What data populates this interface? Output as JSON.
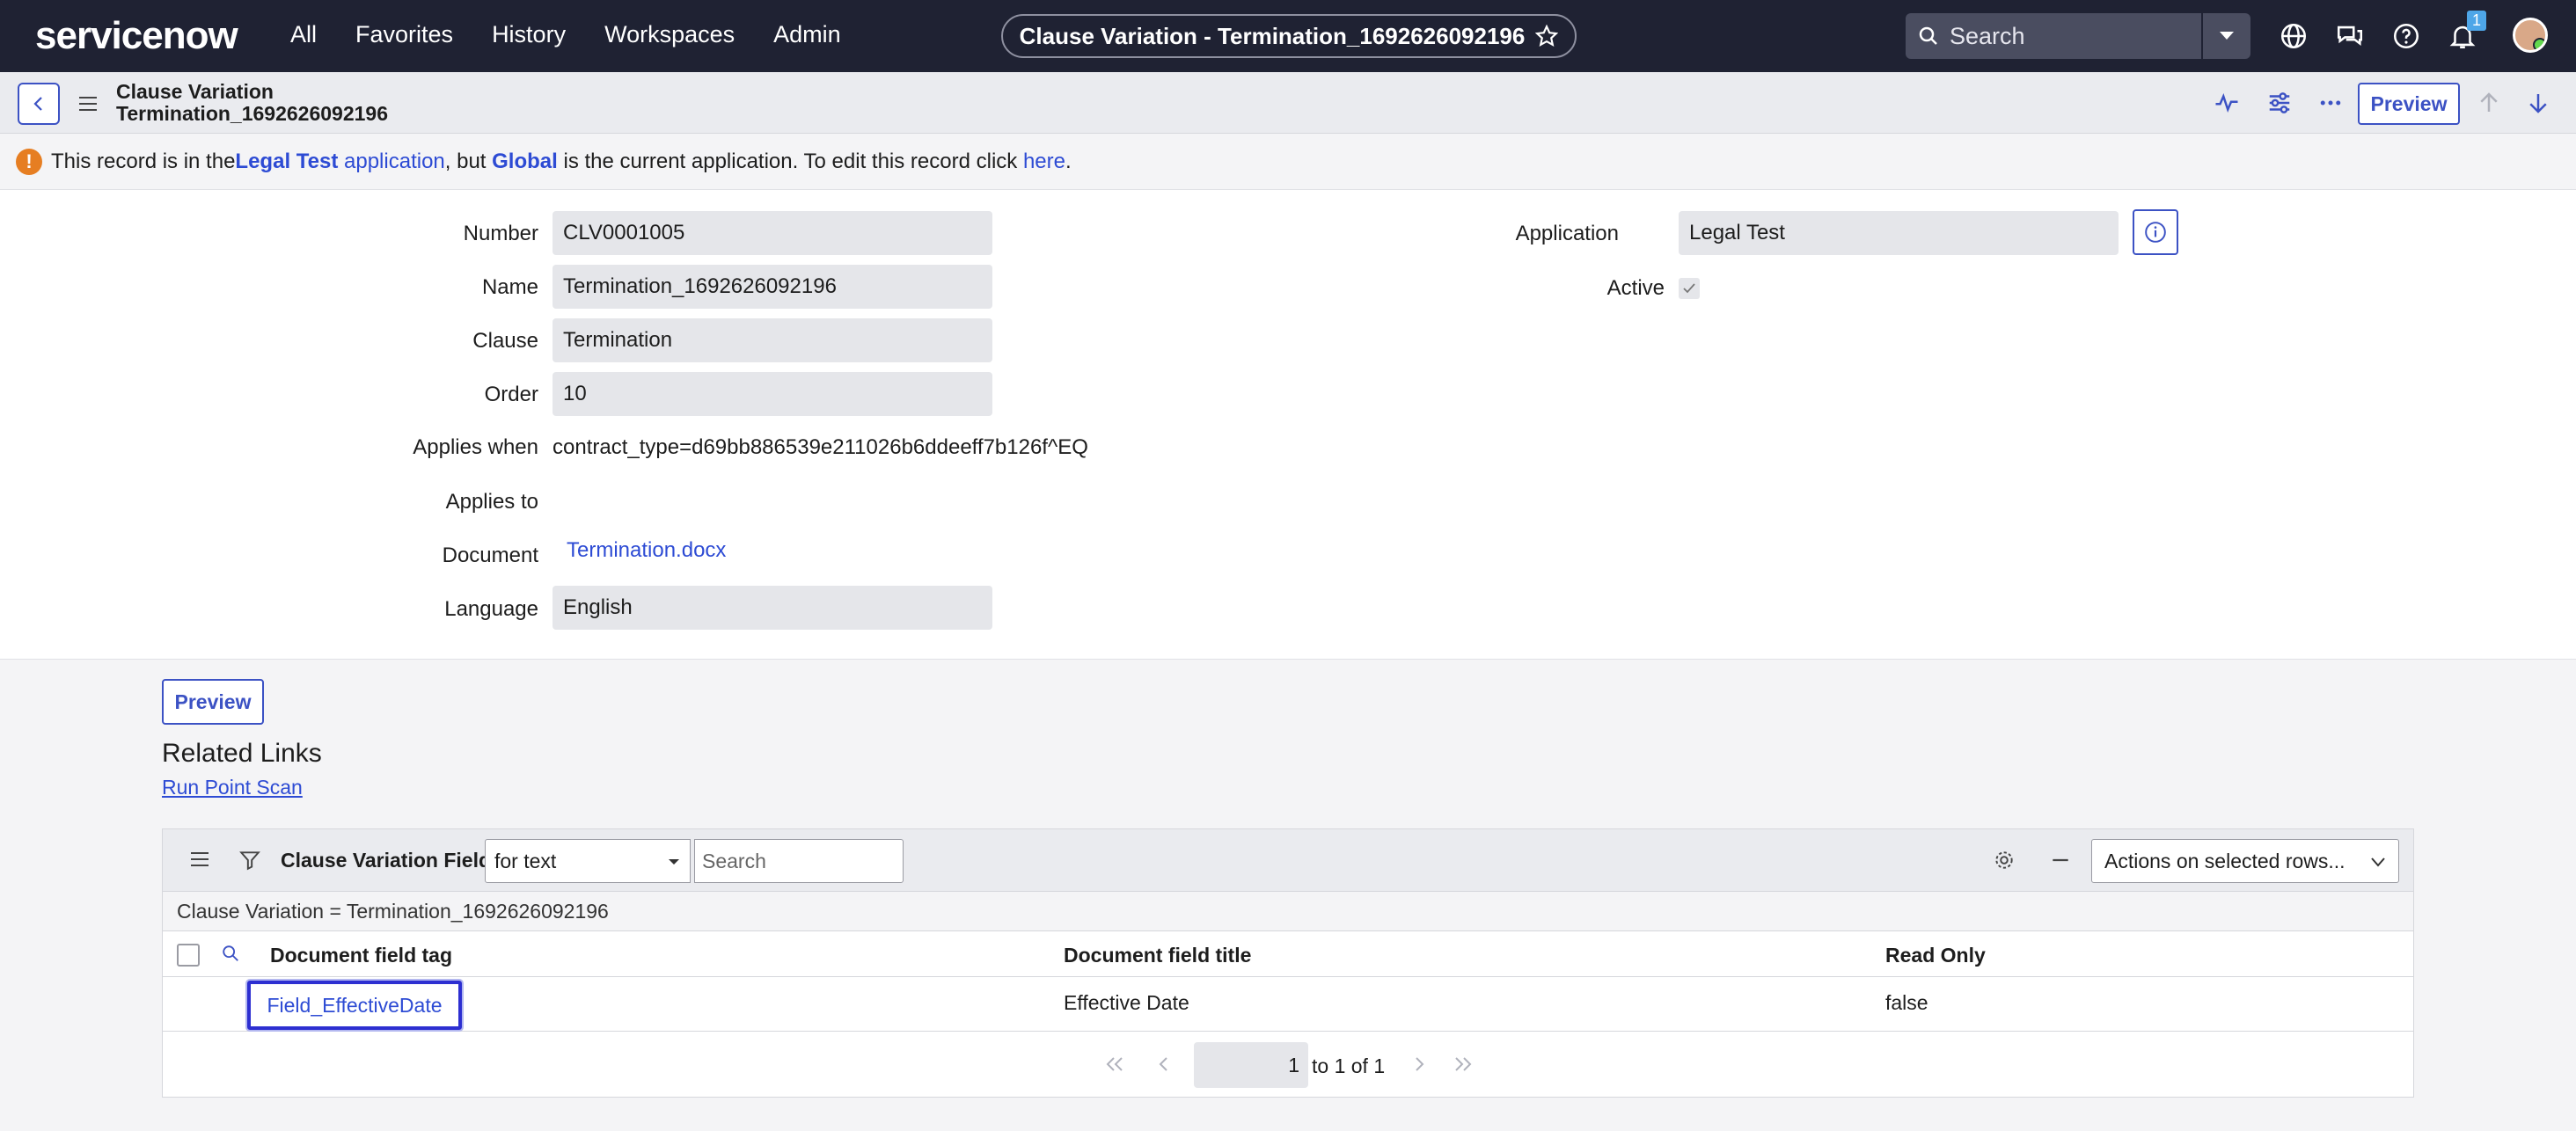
{
  "nav": {
    "logo": "servicenow",
    "links": [
      "All",
      "Favorites",
      "History",
      "Workspaces",
      "Admin"
    ],
    "record_title": "Clause Variation - Termination_1692626092196",
    "search_placeholder": "Search",
    "notification_count": "1"
  },
  "form_header": {
    "title_line1": "Clause Variation",
    "title_line2": "Termination_1692626092196",
    "preview_label": "Preview"
  },
  "banner": {
    "t1": "This record is in the ",
    "app_name": "Legal Test",
    "app_word": " application",
    "t2": ", but ",
    "current_app": "Global",
    "t3": " is the current application. To edit this record click ",
    "here": "here",
    "t4": "."
  },
  "fields": {
    "number_label": "Number",
    "number_value": "CLV0001005",
    "name_label": "Name",
    "name_value": "Termination_1692626092196",
    "clause_label": "Clause",
    "clause_value": "Termination",
    "order_label": "Order",
    "order_value": "10",
    "applies_when_label": "Applies when",
    "applies_when_value": "contract_type=d69bb886539e211026b6ddeeff7b126f^EQ",
    "applies_to_label": "Applies to",
    "document_label": "Document",
    "document_value": "Termination.docx",
    "language_label": "Language",
    "language_value": "English",
    "application_label": "Application",
    "application_value": "Legal Test",
    "active_label": "Active"
  },
  "lower": {
    "preview_label": "Preview",
    "related_links_title": "Related Links",
    "run_point_scan": "Run Point Scan"
  },
  "related_list": {
    "title": "Clause Variation Fields",
    "search_field": "for text",
    "search_placeholder": "Search",
    "actions": "Actions on selected rows...",
    "breadcrumb": "Clause Variation = Termination_1692626092196",
    "columns": [
      "Document field tag",
      "Document field title",
      "Read Only"
    ],
    "rows": [
      [
        "Field_EffectiveDate",
        "Effective Date",
        "false"
      ]
    ],
    "pager_page": "1",
    "pager_text": "to 1 of 1"
  },
  "colors": {
    "nav_bg": "#1f2233",
    "accent": "#3c52c4",
    "link": "#2d4bd4",
    "brand_green": "#62d84e"
  }
}
